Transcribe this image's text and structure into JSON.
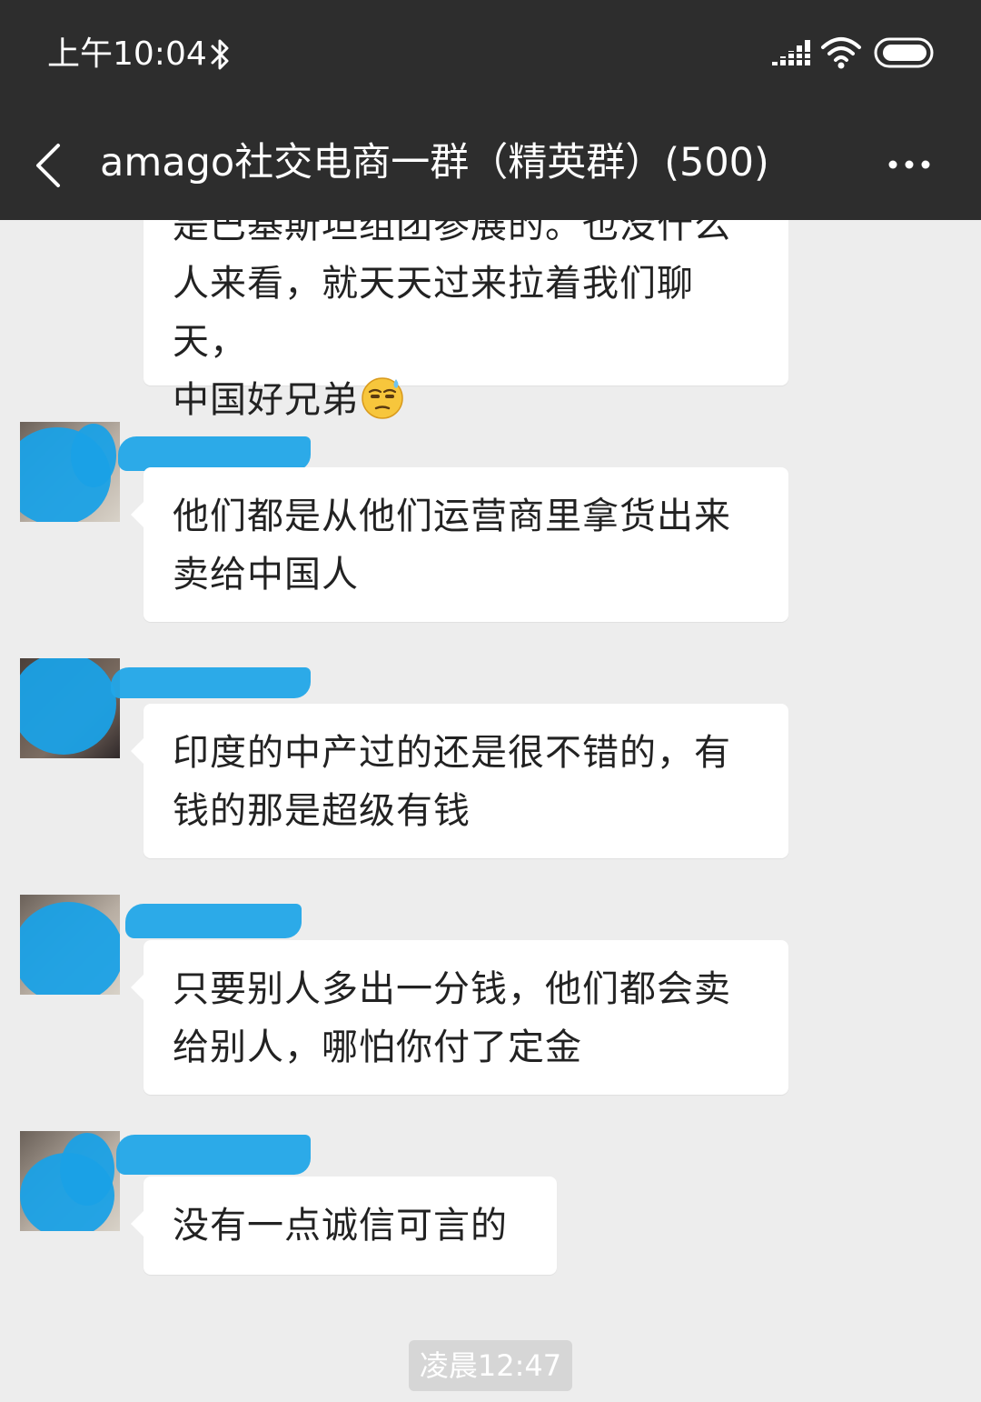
{
  "status_bar": {
    "time": "上午10:04",
    "icons": [
      "bluetooth-icon",
      "signal-icon",
      "wifi-icon",
      "battery-icon"
    ]
  },
  "nav": {
    "title": "amago社交电商一群（精英群）(500)",
    "back_icon": "chevron-left-icon",
    "more_icon": "more-dots-icon"
  },
  "messages": [
    {
      "sender_visible": false,
      "text": "是巴基斯坦组团参展的。也没什么\n人来看，就天天过来拉着我们聊天，\n中国好兄弟",
      "emoji": "sweat-face-emoji"
    },
    {
      "sender_visible": true,
      "text": "他们都是从他们运营商里拿货出来\n卖给中国人"
    },
    {
      "sender_visible": true,
      "text": "印度的中产过的还是很不错的，有\n钱的那是超级有钱"
    },
    {
      "sender_visible": true,
      "text": "只要别人多出一分钱，他们都会卖\n给别人，哪怕你付了定金"
    },
    {
      "sender_visible": true,
      "text": "没有一点诚信可言的"
    }
  ],
  "timestamp": "凌晨12:47",
  "colors": {
    "header_bg": "#2d2d2d",
    "chat_bg": "#ededed",
    "bubble_bg": "#ffffff",
    "redaction_blue": "#1aa1e6",
    "timestamp_bg": "#d6d6d6"
  }
}
